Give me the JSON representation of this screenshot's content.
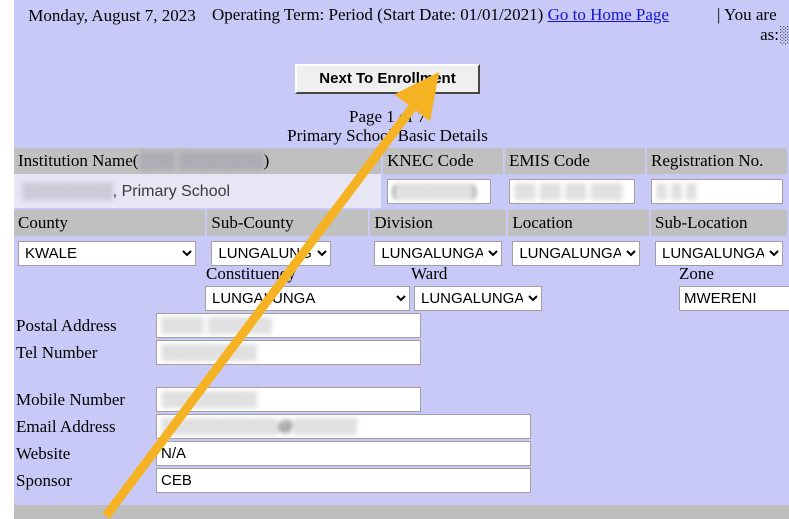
{
  "header": {
    "date": "Monday, August 7, 2023",
    "operating_term": "Operating Term: Period (Start Date: 01/01/2021)",
    "home_link": "Go to Home Page",
    "separator": "|",
    "logged_in_line1": "You are",
    "logged_in_line2": "as:░"
  },
  "toolbar": {
    "next_label": "Next To Enrollment"
  },
  "titles": {
    "page_indicator": "Page 1 of 7",
    "section": "Primary School Basic Details"
  },
  "institution": {
    "name_header_prefix": "Institution Name(",
    "name_header_code": "░░░ ░░░░░░░",
    "name_header_suffix": ")",
    "name_value_redacted": "░░░░░░░░",
    "name_value_suffix": ", Primary School",
    "knec_label": "KNEC Code",
    "knec_value": "(░░░░░░░)",
    "emis_label": "EMIS Code",
    "emis_value": "░░ ░░ ░░ ░░░",
    "reg_label": "Registration No.",
    "reg_value": "░ ░ ░"
  },
  "geography": {
    "county_label": "County",
    "county_value": "KWALE",
    "subcounty_label": "Sub-County",
    "subcounty_value": "LUNGALUNGA",
    "division_label": "Division",
    "division_value": "LUNGALUNGA",
    "location_label": "Location",
    "location_value": "LUNGALUNGA",
    "sublocation_label": "Sub-Location",
    "sublocation_value": "LUNGALUNGA",
    "constituency_label": "Constituency",
    "constituency_value": "LUNGALUNGA",
    "ward_label": "Ward",
    "ward_value": "LUNGALUNGA",
    "zone_label": "Zone",
    "zone_value": "MWERENI"
  },
  "contact": {
    "postal_label": "Postal Address",
    "postal_value": "░░░░ ░░░░░░",
    "tel_label": "Tel Number",
    "tel_value": "░░░░░░░░░",
    "mobile_label": "Mobile Number",
    "mobile_value": "░░░░░░░░░",
    "email_label": "Email Address",
    "email_value": "░░░░░░░░░░░@░░░░░░",
    "website_label": "Website",
    "website_value": "N/A",
    "sponsor_label": "Sponsor",
    "sponsor_value": "CEB"
  },
  "annotation": {
    "arrow_color": "#f5b324"
  },
  "colors": {
    "page_background": "#c9c9f7",
    "table_header": "#c0c0c0",
    "link": "#1414d2",
    "footer": "#bdbdbd"
  }
}
